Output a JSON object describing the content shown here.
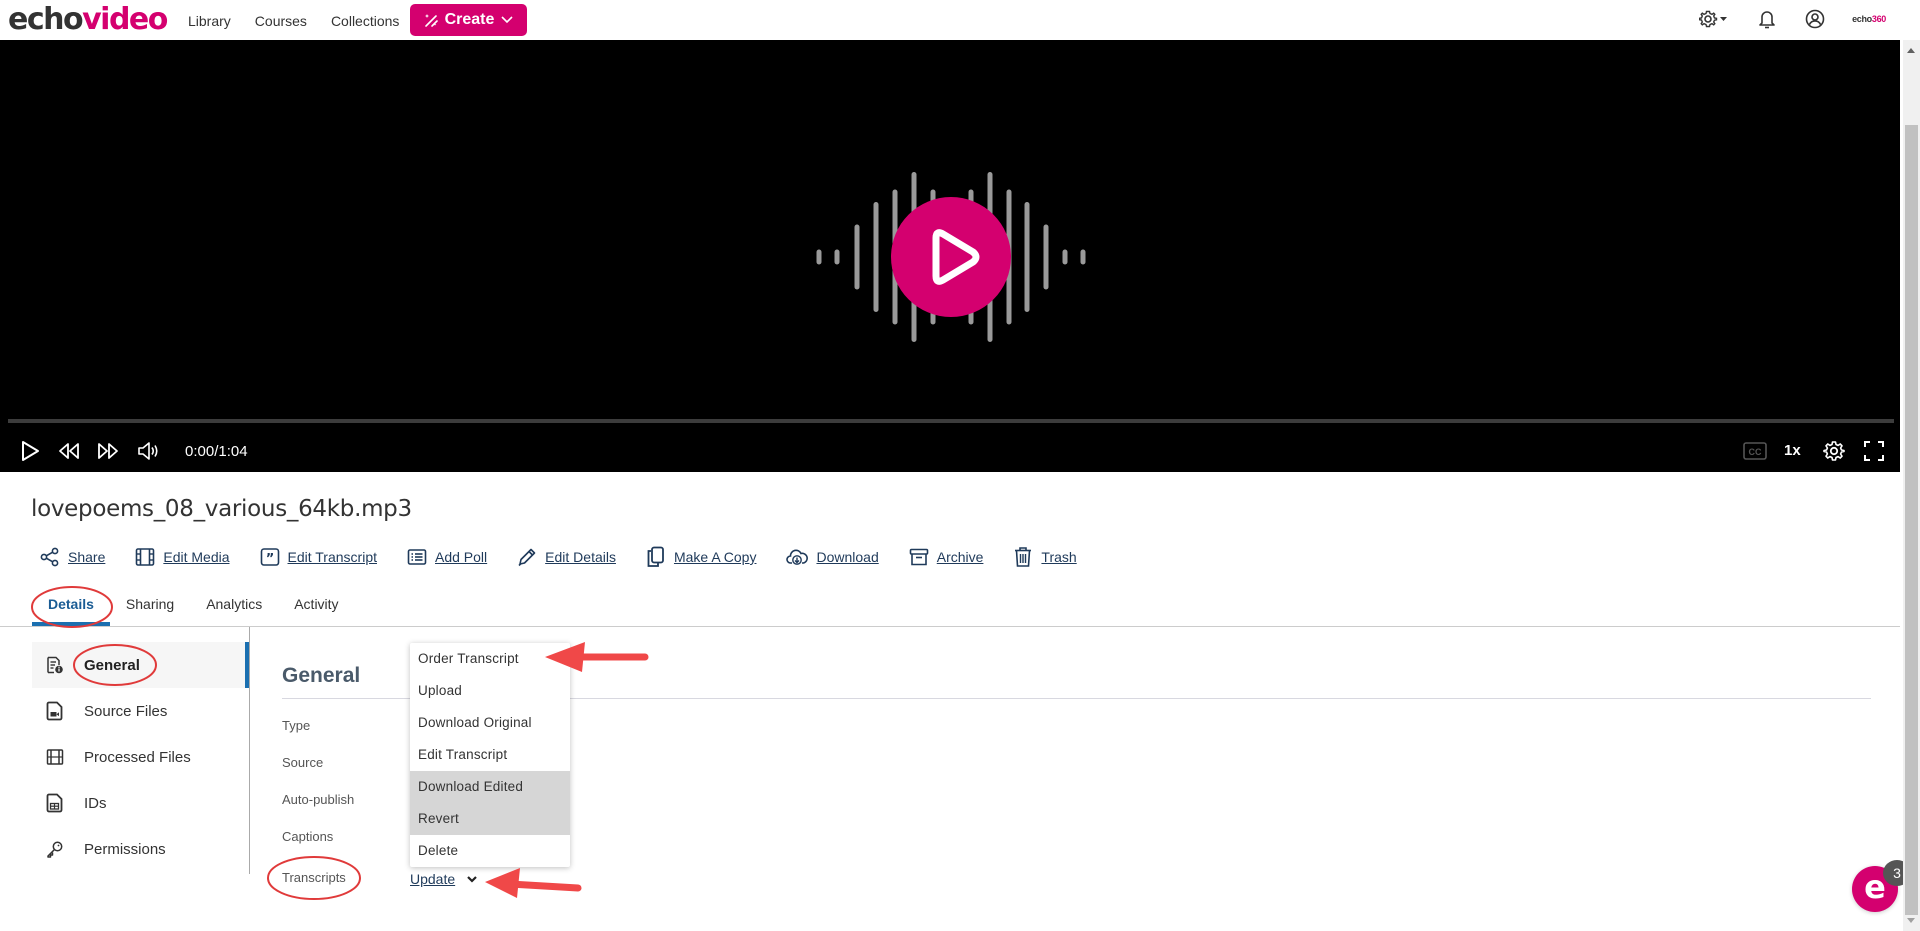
{
  "brand": {
    "logo_part1": "echo",
    "logo_part2": "video",
    "mini_logo_part1": "echo",
    "mini_logo_part2": "360",
    "accent_color": "#d4006f"
  },
  "nav": {
    "links": [
      "Library",
      "Courses",
      "Collections"
    ],
    "create_label": "Create",
    "icons": [
      "settings-icon",
      "bell-icon",
      "user-icon"
    ]
  },
  "player": {
    "current_time": "0:00",
    "duration": "1:04",
    "time_display": "0:00/1:04",
    "progress": 0,
    "speed": "1x",
    "cc_label": "CC"
  },
  "media": {
    "title": "lovepoems_08_various_64kb.mp3"
  },
  "actions": [
    {
      "label": "Share",
      "icon": "share-icon"
    },
    {
      "label": "Edit Media",
      "icon": "film-icon"
    },
    {
      "label": "Edit Transcript",
      "icon": "quote-icon"
    },
    {
      "label": "Add Poll",
      "icon": "list-icon"
    },
    {
      "label": "Edit Details",
      "icon": "pencil-icon"
    },
    {
      "label": "Make A Copy",
      "icon": "copy-icon"
    },
    {
      "label": "Download",
      "icon": "cloud-download-icon"
    },
    {
      "label": "Archive",
      "icon": "archive-icon"
    },
    {
      "label": "Trash",
      "icon": "trash-icon"
    }
  ],
  "tabs": [
    {
      "label": "Details",
      "active": true
    },
    {
      "label": "Sharing",
      "active": false
    },
    {
      "label": "Analytics",
      "active": false
    },
    {
      "label": "Activity",
      "active": false
    }
  ],
  "sidenav": [
    {
      "label": "General",
      "icon": "document-info-icon",
      "active": true
    },
    {
      "label": "Source Files",
      "icon": "video-file-icon",
      "active": false
    },
    {
      "label": "Processed Files",
      "icon": "film-icon",
      "active": false
    },
    {
      "label": "IDs",
      "icon": "id-file-icon",
      "active": false
    },
    {
      "label": "Permissions",
      "icon": "key-icon",
      "active": false
    }
  ],
  "general": {
    "title": "General",
    "fields": [
      "Type",
      "Source",
      "Auto-publish",
      "Captions",
      "Transcripts"
    ],
    "transcripts_action": "Update"
  },
  "transcript_menu": {
    "items": [
      {
        "label": "Order Transcript",
        "highlighted": false
      },
      {
        "label": "Upload",
        "highlighted": false
      },
      {
        "label": "Download Original",
        "highlighted": false
      },
      {
        "label": "Edit Transcript",
        "highlighted": false
      },
      {
        "label": "Download Edited",
        "highlighted": true
      },
      {
        "label": "Revert",
        "highlighted": true
      },
      {
        "label": "Delete",
        "highlighted": false
      }
    ]
  },
  "chat": {
    "badge_count": "3",
    "glyph": "e"
  }
}
